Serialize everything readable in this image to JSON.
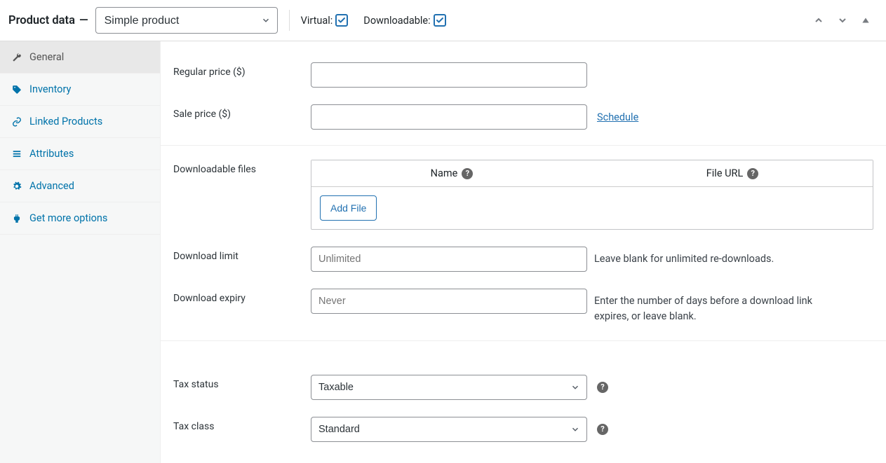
{
  "header": {
    "title": "Product data",
    "dash": "—",
    "product_type": "Simple product",
    "virtual_label": "Virtual:",
    "virtual_checked": true,
    "downloadable_label": "Downloadable:",
    "downloadable_checked": true
  },
  "sidebar": {
    "items": [
      {
        "id": "general",
        "label": "General",
        "active": true
      },
      {
        "id": "inventory",
        "label": "Inventory",
        "active": false
      },
      {
        "id": "linked",
        "label": "Linked Products",
        "active": false
      },
      {
        "id": "attributes",
        "label": "Attributes",
        "active": false
      },
      {
        "id": "advanced",
        "label": "Advanced",
        "active": false
      },
      {
        "id": "more",
        "label": "Get more options",
        "active": false
      }
    ]
  },
  "fields": {
    "regular_price": {
      "label": "Regular price ($)",
      "value": ""
    },
    "sale_price": {
      "label": "Sale price ($)",
      "value": "",
      "schedule": "Schedule"
    },
    "downloadable_files": {
      "label": "Downloadable files",
      "col_name": "Name",
      "col_url": "File URL",
      "add_file": "Add File"
    },
    "download_limit": {
      "label": "Download limit",
      "placeholder": "Unlimited",
      "value": "",
      "help": "Leave blank for unlimited re-downloads."
    },
    "download_expiry": {
      "label": "Download expiry",
      "placeholder": "Never",
      "value": "",
      "help": "Enter the number of days before a download link expires, or leave blank."
    },
    "tax_status": {
      "label": "Tax status",
      "value": "Taxable"
    },
    "tax_class": {
      "label": "Tax class",
      "value": "Standard"
    }
  },
  "help_symbol": "?"
}
